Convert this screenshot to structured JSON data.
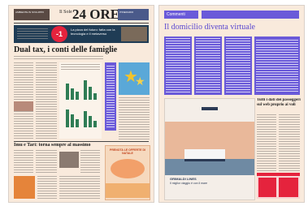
{
  "left_page": {
    "masthead": {
      "title": "24 ORE",
      "prefix": "Il Sole",
      "box_left": "AMBIENTE IN SVILUPPO",
      "box_right": "ITINERARIO"
    },
    "banner": {
      "headline": "La pizza del futuro: fatta con la tecnologia e il metaverso",
      "badge": "-1"
    },
    "main_headline": "Dual tax, i conti delle famiglie",
    "second_headline": "Imu e Tari: torna sempre al massimo",
    "ad_text": "PRENOTA LE OFFERTE DI NATALE"
  },
  "right_page": {
    "header_tab": "Commenti",
    "headline": "Il domicilio diventa virtuale",
    "side_headline": "Tutti i dati dei passeggeri sul web proprio ai voli",
    "ad": {
      "brand": "GRIMALDI LINES",
      "tagline": "Il miglior viaggio è con il mare"
    }
  },
  "colors": {
    "page_bg": "#f9eadc",
    "accent_blue": "#6a5ad9",
    "accent_red": "#e5233d",
    "chart_green": "#2f7d55",
    "ad_orange": "#f2a06a",
    "ship_sea": "#e9b89a"
  }
}
